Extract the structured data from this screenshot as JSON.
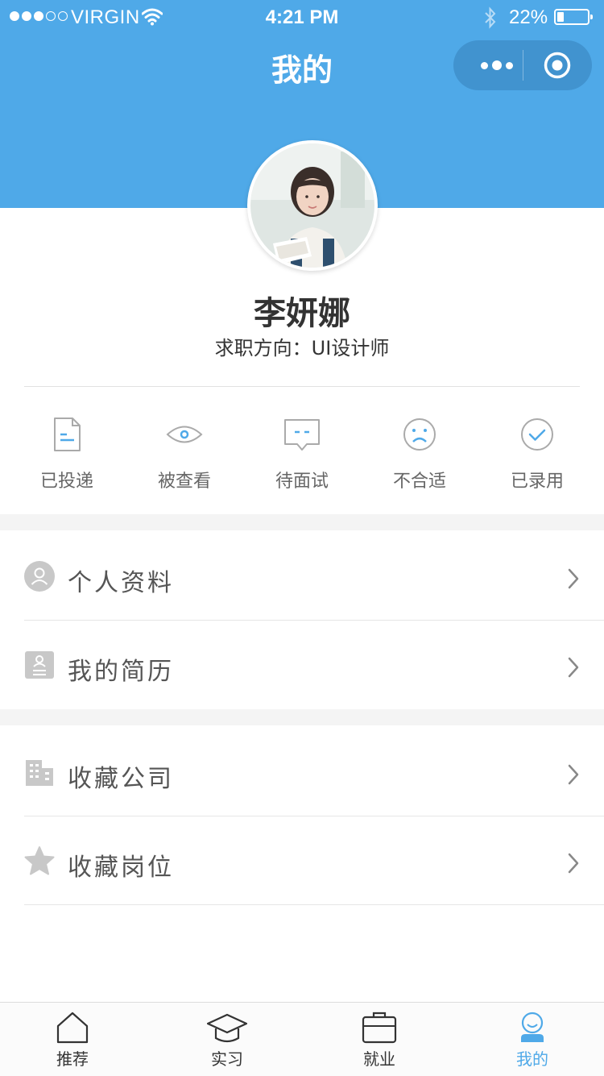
{
  "status_bar": {
    "carrier": "VIRGIN",
    "time": "4:21 PM",
    "battery": "22%",
    "battery_level": 0.22,
    "signal_bars": 3
  },
  "header": {
    "title": "我的"
  },
  "profile": {
    "name": "李妍娜",
    "job_intent": "求职方向：UI设计师"
  },
  "stats": [
    {
      "label": "已投递",
      "icon": "document-icon"
    },
    {
      "label": "被查看",
      "icon": "eye-icon"
    },
    {
      "label": "待面试",
      "icon": "chat-icon"
    },
    {
      "label": "不合适",
      "icon": "sad-face-icon"
    },
    {
      "label": "已录用",
      "icon": "check-circle-icon"
    }
  ],
  "menu_group_1": [
    {
      "label": "个人资料",
      "icon": "person-icon"
    },
    {
      "label": "我的简历",
      "icon": "resume-icon"
    }
  ],
  "menu_group_2": [
    {
      "label": "收藏公司",
      "icon": "building-icon"
    },
    {
      "label": "收藏岗位",
      "icon": "star-icon"
    }
  ],
  "tabbar": [
    {
      "label": "推荐",
      "icon": "home-icon"
    },
    {
      "label": "实习",
      "icon": "graduation-cap-icon"
    },
    {
      "label": "就业",
      "icon": "briefcase-icon"
    },
    {
      "label": "我的",
      "icon": "user-face-icon",
      "active": true
    }
  ],
  "colors": {
    "primary": "#4fa9e8",
    "icon_gray": "#b3b3b3",
    "text": "#333333",
    "subtext": "#666666"
  }
}
